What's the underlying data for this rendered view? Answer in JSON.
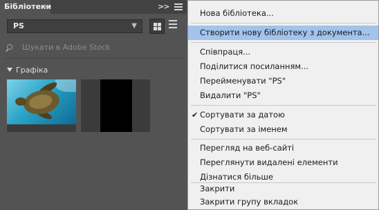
{
  "panel": {
    "tab_title": "Бібліотеки",
    "tab_close": "×",
    "collapse_glyph": ">>",
    "library_selected": "PS",
    "search_placeholder": "Шукати в Adobe Stock",
    "section_title": "Графіка"
  },
  "menu": {
    "items": [
      {
        "label": "Нова бібліотека...",
        "highlighted": false
      },
      {
        "label": "Створити нову бібліотеку з документа...",
        "highlighted": true
      },
      {
        "label": "Співпраця..."
      },
      {
        "label": "Поділитися посиланням..."
      },
      {
        "label": "Перейменувати \"PS\""
      },
      {
        "label": "Видалити \"PS\""
      },
      {
        "label": "Сортувати за датою",
        "checked": true
      },
      {
        "label": "Сортувати за іменем"
      },
      {
        "label": "Перегляд на веб-сайті"
      },
      {
        "label": "Переглянути видалені елементи"
      },
      {
        "label": "Дізнатися більше"
      },
      {
        "label": "Закрити"
      },
      {
        "label": "Закрити групу вкладок"
      }
    ],
    "check_glyph": "✔"
  },
  "colors": {
    "panel_bg": "#535353",
    "menu_bg": "#f0f0f0",
    "highlight": "#a2c3ec"
  },
  "icons": [
    "search-icon",
    "chevron-down-icon",
    "grid-view-icon",
    "list-view-icon",
    "panel-menu-icon",
    "collapse-icon",
    "disclosure-triangle-icon",
    "checkmark-icon"
  ]
}
